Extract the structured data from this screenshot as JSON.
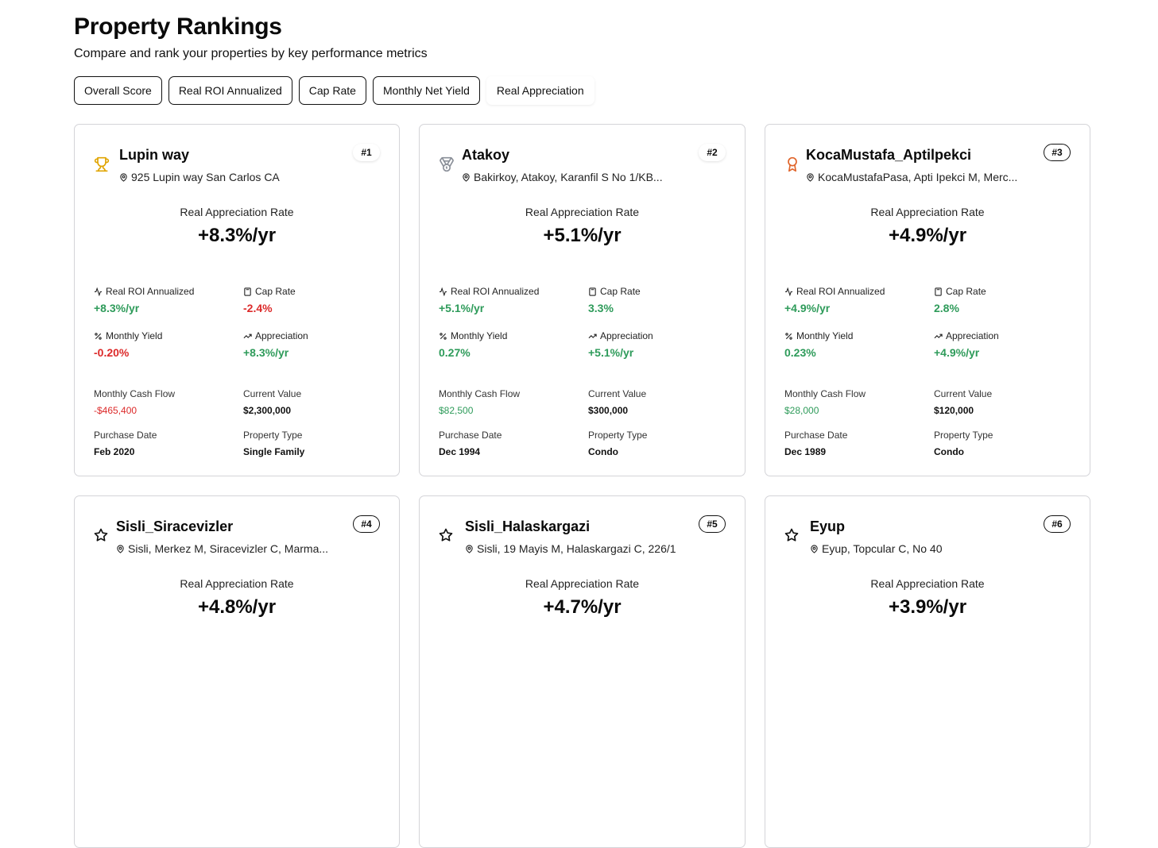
{
  "header": {
    "title": "Property Rankings",
    "subtitle": "Compare and rank your properties by key performance metrics"
  },
  "tabs": [
    {
      "label": "Overall Score",
      "active": false
    },
    {
      "label": "Real ROI Annualized",
      "active": false
    },
    {
      "label": "Cap Rate",
      "active": false
    },
    {
      "label": "Monthly Net Yield",
      "active": false
    },
    {
      "label": "Real Appreciation",
      "active": true
    }
  ],
  "labels": {
    "metric": "Real Appreciation Rate",
    "roi": "Real ROI Annualized",
    "cap": "Cap Rate",
    "yield": "Monthly Yield",
    "appreciation": "Appreciation",
    "cash_flow": "Monthly Cash Flow",
    "current_value": "Current Value",
    "purchase_date": "Purchase Date",
    "property_type": "Property Type"
  },
  "colors": {
    "positive": "#2e9b5a",
    "negative": "#dc2a2a",
    "gold": "#e0a400",
    "silver": "#8a8f98",
    "bronze": "#e0642a"
  },
  "properties": [
    {
      "rank": "#1",
      "icon": "trophy-icon",
      "name": "Lupin way",
      "address": "925 Lupin way San Carlos CA",
      "metric_value": "+8.3%/yr",
      "roi": "+8.3%/yr",
      "cap": "-2.4%",
      "yield": "-0.20%",
      "appreciation": "+8.3%/yr",
      "cash_flow": "-$465,400",
      "current_value": "$2,300,000",
      "purchase_date": "Feb 2020",
      "property_type": "Single Family"
    },
    {
      "rank": "#2",
      "icon": "medal-icon",
      "name": "Atakoy",
      "address": "Bakirkoy, Atakoy, Karanfil S No 1/KB...",
      "metric_value": "+5.1%/yr",
      "roi": "+5.1%/yr",
      "cap": "3.3%",
      "yield": "0.27%",
      "appreciation": "+5.1%/yr",
      "cash_flow": "$82,500",
      "current_value": "$300,000",
      "purchase_date": "Dec 1994",
      "property_type": "Condo"
    },
    {
      "rank": "#3",
      "icon": "award-icon",
      "name": "KocaMustafa_Aptilpekci",
      "address": "KocaMustafaPasa, Apti Ipekci M, Merc...",
      "metric_value": "+4.9%/yr",
      "roi": "+4.9%/yr",
      "cap": "2.8%",
      "yield": "0.23%",
      "appreciation": "+4.9%/yr",
      "cash_flow": "$28,000",
      "current_value": "$120,000",
      "purchase_date": "Dec 1989",
      "property_type": "Condo"
    },
    {
      "rank": "#4",
      "icon": "star-icon",
      "name": "Sisli_Siracevizler",
      "address": "Sisli, Merkez M, Siracevizler C, Marma...",
      "metric_value": "+4.8%/yr"
    },
    {
      "rank": "#5",
      "icon": "star-icon",
      "name": "Sisli_Halaskargazi",
      "address": "Sisli, 19 Mayis M, Halaskargazi C, 226/1",
      "metric_value": "+4.7%/yr"
    },
    {
      "rank": "#6",
      "icon": "star-icon",
      "name": "Eyup",
      "address": "Eyup, Topcular C, No 40",
      "metric_value": "+3.9%/yr"
    }
  ]
}
